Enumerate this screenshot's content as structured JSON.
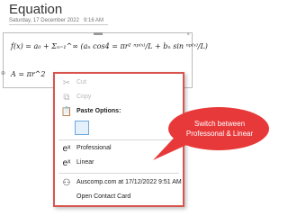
{
  "page": {
    "title": "Equation",
    "date": "Saturday, 17 December 2022",
    "time": "9:16 AM"
  },
  "equation": {
    "line1": "f(x) = a₀ + Σₙ₌₁^∞ (aₙ cos4 = πr² ⁿᵖ⁽ˣ⁾/L + bₙ sin ⁿᵖ⁽ˣ⁾/L)",
    "line2": "A = πr^2",
    "close_glyph": "×",
    "handle_glyph": "⊕"
  },
  "context_menu": {
    "items": [
      {
        "label": "Cut",
        "icon": "scissors-icon",
        "glyph": "✂",
        "enabled": false
      },
      {
        "label": "Copy",
        "icon": "copy-icon",
        "glyph": "⧉",
        "enabled": false
      },
      {
        "label": "Paste Options:",
        "icon": "clipboard-icon",
        "glyph": "📋",
        "enabled": true
      },
      {
        "label": "Professional",
        "icon": "professional-equation-icon",
        "glyph": "eˣ",
        "enabled": true
      },
      {
        "label": "Linear",
        "icon": "linear-equation-icon",
        "glyph": "eˣ",
        "enabled": true
      },
      {
        "label": "Auscomp.com at 17/12/2022 9:51 AM",
        "icon": "person-icon",
        "glyph": "⚇",
        "enabled": true
      },
      {
        "label": "Open Contact Card",
        "icon": "",
        "glyph": "",
        "enabled": true
      }
    ]
  },
  "callout": {
    "text_line1": "Switch between",
    "text_line2": "Professonal & Linear",
    "color": "#e8393a"
  }
}
